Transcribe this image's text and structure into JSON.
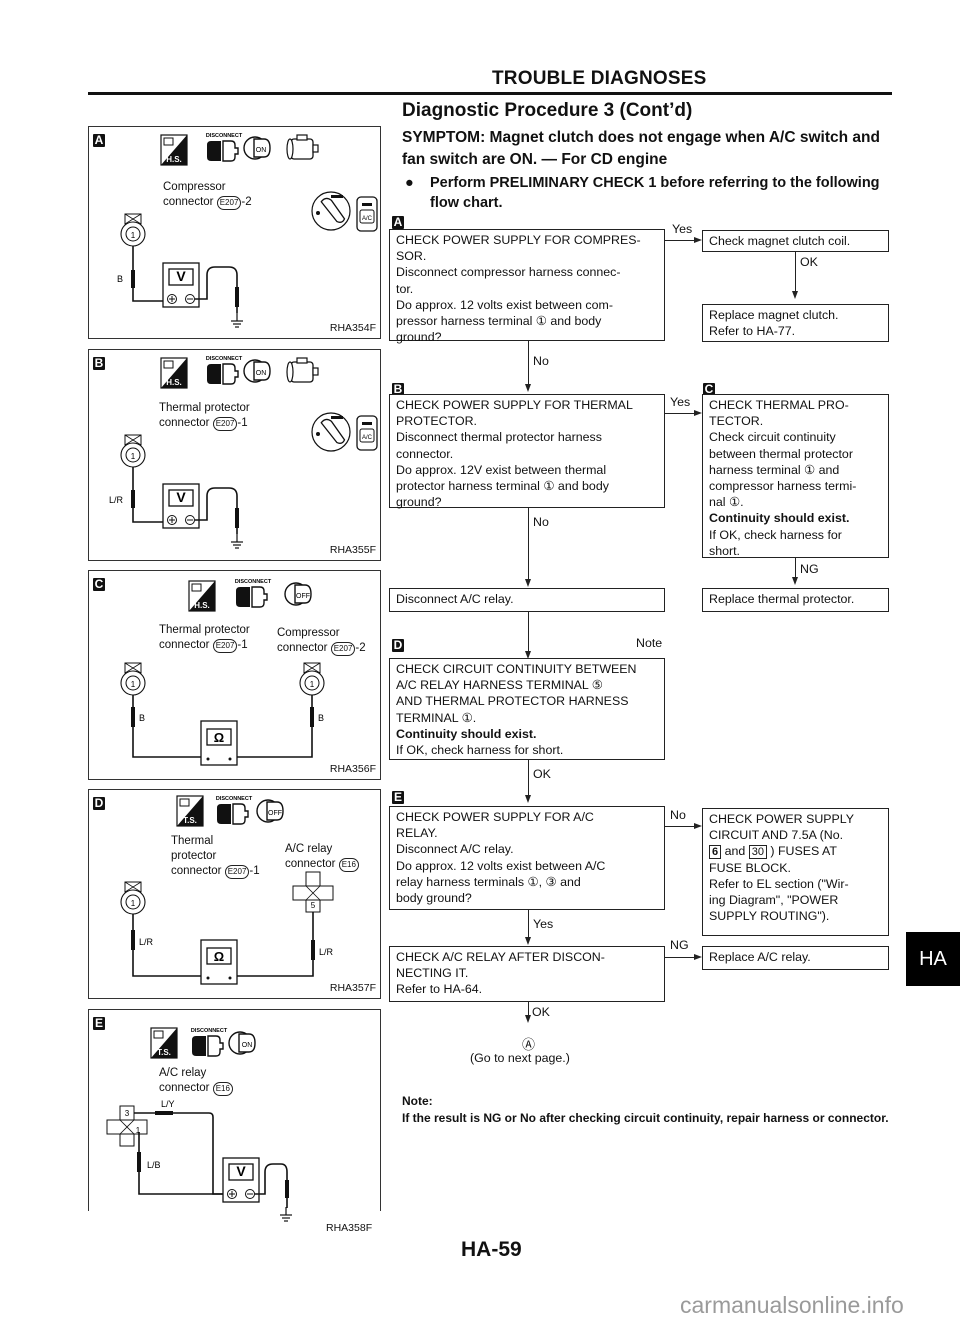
{
  "header": {
    "section_title": "TROUBLE DIAGNOSES",
    "procedure_title": "Diagnostic Procedure 3 (Cont’d)",
    "symptom": "SYMPTOM: Magnet clutch does not engage when A/C switch and fan switch are ON. — For CD engine",
    "bullet_text": "Perform PRELIMINARY CHECK 1 before referring to the following flow chart."
  },
  "panels": [
    {
      "badge": "A",
      "icons": [
        "harness-side-icon",
        "disconnect-icon",
        "ignition-on-icon",
        "engine-running-icon",
        "fan-switch-icon",
        "ac-switch-icon"
      ],
      "icon_labels": {
        "hs": "H.S.",
        "disconnect": "DISCONNECT",
        "ign": "ON",
        "ac": "A/C"
      },
      "connector_name": "Compressor",
      "connector_line": "connector",
      "connector_id": "E207",
      "connector_suffix": "-2",
      "terminal": "1",
      "wire_color": "B",
      "meter": "V",
      "code": "RHA354F"
    },
    {
      "badge": "B",
      "icon_labels": {
        "hs": "H.S.",
        "disconnect": "DISCONNECT",
        "ign": "ON",
        "ac": "A/C"
      },
      "connector_name": "Thermal protector",
      "connector_line": "connector",
      "connector_id": "E207",
      "connector_suffix": "-1",
      "terminal": "1",
      "wire_color": "L/R",
      "meter": "V",
      "code": "RHA355F"
    },
    {
      "badge": "C",
      "icon_labels": {
        "hs": "H.S.",
        "disconnect": "DISCONNECT",
        "ign": "OFF"
      },
      "left_name": "Thermal protector",
      "left_line": "connector",
      "left_id": "E207",
      "left_suffix": "-1",
      "right_name": "Compressor",
      "right_line": "connector",
      "right_id": "E207",
      "right_suffix": "-2",
      "left_terminal": "1",
      "right_terminal": "1",
      "left_wire": "B",
      "right_wire": "B",
      "meter": "Ω",
      "code": "RHA356F"
    },
    {
      "badge": "D",
      "icon_labels": {
        "ts": "T.S.",
        "disconnect": "DISCONNECT",
        "ign": "OFF"
      },
      "left_name1": "Thermal",
      "left_name2": "protector",
      "left_line": "connector",
      "left_id": "E207",
      "left_suffix": "-1",
      "right_name": "A/C relay",
      "right_line": "connector",
      "right_id": "E16",
      "left_terminal": "1",
      "right_terminal": "5",
      "left_wire": "L/R",
      "right_wire": "L/R",
      "meter": "Ω",
      "code": "RHA357F"
    },
    {
      "badge": "E",
      "icon_labels": {
        "ts": "T.S.",
        "disconnect": "DISCONNECT",
        "ign": "ON"
      },
      "connector_name": "A/C relay",
      "connector_line": "connector",
      "connector_id": "E16",
      "terminal_top": "3",
      "terminal_mid": "1",
      "wire_top": "L/Y",
      "wire_mid": "L/B",
      "meter": "V",
      "code": "RHA358F"
    }
  ],
  "flowchart": {
    "A": {
      "badge": "A",
      "lines": [
        "CHECK POWER SUPPLY FOR COMPRES-",
        "SOR.",
        "Disconnect compressor harness connec-",
        "tor.",
        "Do approx. 12 volts exist between com-",
        "pressor harness terminal ① and body",
        "ground?"
      ],
      "yes_label": "Yes",
      "no_label": "No"
    },
    "A_yes": {
      "text": "Check magnet clutch coil.",
      "ok_label": "OK"
    },
    "A_yes_ok": {
      "lines": [
        "Replace magnet clutch.",
        "Refer to HA-77."
      ]
    },
    "B": {
      "badge": "B",
      "lines": [
        "CHECK POWER SUPPLY FOR THERMAL",
        "PROTECTOR.",
        "Disconnect thermal protector harness",
        "connector.",
        "Do approx. 12V exist between thermal",
        "protector harness terminal ① and body",
        "ground?"
      ],
      "yes_label": "Yes",
      "no_label": "No"
    },
    "C": {
      "badge": "C",
      "lines": [
        "CHECK THERMAL PRO-",
        "TECTOR.",
        "Check circuit continuity",
        "between thermal protector",
        "harness terminal ① and",
        "compressor harness termi-",
        "nal ①."
      ],
      "bold_line": "Continuity should exist.",
      "tail_lines": [
        "If OK, check harness for",
        "short."
      ],
      "ng_label": "NG"
    },
    "C_ng": {
      "text": "Replace thermal protector."
    },
    "disconnect_relay": {
      "text": "Disconnect A/C relay."
    },
    "D": {
      "badge": "D",
      "note_label": "Note",
      "lines": [
        "CHECK CIRCUIT CONTINUITY BETWEEN",
        "A/C RELAY HARNESS TERMINAL ⑤",
        "AND THERMAL PROTECTOR HARNESS",
        "TERMINAL ①."
      ],
      "bold_line": "Continuity should exist.",
      "tail_lines": [
        "If OK, check harness for short."
      ],
      "ok_label": "OK"
    },
    "E": {
      "badge": "E",
      "lines": [
        "CHECK POWER SUPPLY FOR A/C",
        "RELAY.",
        "Disconnect A/C relay.",
        "Do approx. 12 volts exist between A/C",
        "relay harness terminals ①, ③ and",
        "body ground?"
      ],
      "no_label": "No",
      "yes_label": "Yes"
    },
    "E_no": {
      "line1": "CHECK POWER SUPPLY",
      "line2": "CIRCUIT AND 7.5A (No.",
      "fuse1": "6",
      "and_word": "and",
      "fuse2": "30",
      "line3_tail": ") FUSES AT",
      "line4": "FUSE BLOCK.",
      "lines_rest": [
        "Refer to EL section (\"Wir-",
        "ing Diagram\", \"POWER",
        "SUPPLY ROUTING\")."
      ]
    },
    "F": {
      "lines": [
        "CHECK A/C RELAY AFTER DISCON-",
        "NECTING IT.",
        "Refer to HA-64."
      ],
      "ng_label": "NG",
      "ok_label": "OK"
    },
    "F_ng": {
      "text": "Replace A/C relay."
    },
    "continuation": {
      "marker": "Ⓐ",
      "text": "(Go to next page.)"
    }
  },
  "note": {
    "title": "Note:",
    "body": "If the result is NG or No after checking circuit continuity, repair harness or connector."
  },
  "footer": {
    "page_number": "HA-59",
    "section_tab": "HA",
    "watermark": "carmanualsonline.info"
  }
}
